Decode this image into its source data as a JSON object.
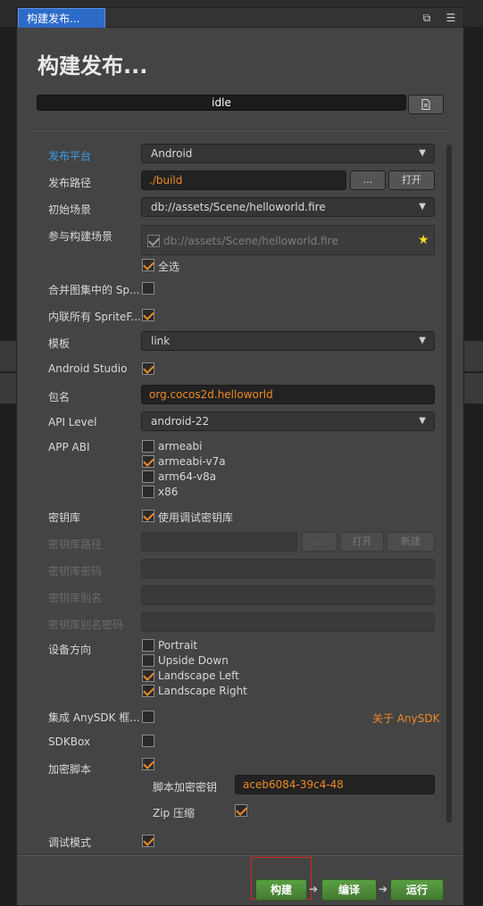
{
  "tab": {
    "title": "构建发布..."
  },
  "header": {
    "title": "构建发布..."
  },
  "progress": {
    "status": "idle"
  },
  "fields": {
    "platform": {
      "label": "发布平台",
      "value": "Android"
    },
    "path": {
      "label": "发布路径",
      "value": "./build",
      "browse_label": "...",
      "open_label": "打开"
    },
    "start_scene": {
      "label": "初始场景",
      "value": "db://assets/Scene/helloworld.fire"
    },
    "scenes": {
      "label": "参与构建场景",
      "item": "db://assets/Scene/helloworld.fire",
      "select_all": "全选"
    },
    "merge_atlas": {
      "label": "合并图集中的 Sp..."
    },
    "inline_sprite": {
      "label": "内联所有 SpriteF..."
    },
    "template": {
      "label": "模板",
      "value": "link"
    },
    "android_studio": {
      "label": "Android Studio"
    },
    "package": {
      "label": "包名",
      "value": "org.cocos2d.helloworld"
    },
    "api_level": {
      "label": "API Level",
      "value": "android-22"
    },
    "app_abi": {
      "label": "APP ABI",
      "options": [
        "armeabi",
        "armeabi-v7a",
        "arm64-v8a",
        "x86"
      ]
    },
    "keystore": {
      "label": "密钥库",
      "use_debug": "使用调试密钥库"
    },
    "keystore_path": {
      "label": "密钥库路径",
      "browse_label": "...",
      "open_label": "打开",
      "new_label": "新建"
    },
    "keystore_pwd": {
      "label": "密钥库密码"
    },
    "keystore_alias": {
      "label": "密钥库别名"
    },
    "keystore_alias_pwd": {
      "label": "密钥库别名密码"
    },
    "orientation": {
      "label": "设备方向",
      "options": [
        "Portrait",
        "Upside Down",
        "Landscape Left",
        "Landscape Right"
      ]
    },
    "anysdk": {
      "label": "集成 AnySDK 框...",
      "link": "关于 AnySDK"
    },
    "sdkbox": {
      "label": "SDKBox"
    },
    "encrypt": {
      "label": "加密脚本",
      "key_label": "脚本加密密钥",
      "key_value": "aceb6084-39c4-48",
      "zip_label": "Zip 压缩"
    },
    "debug": {
      "label": "调试模式"
    }
  },
  "actions": {
    "build": "构建",
    "compile": "编译",
    "run": "运行"
  },
  "colors": {
    "accent": "#f08a24",
    "active_label": "#3b9ce8",
    "tab": "#2d6bc9",
    "action_green": "#4d8a38"
  }
}
